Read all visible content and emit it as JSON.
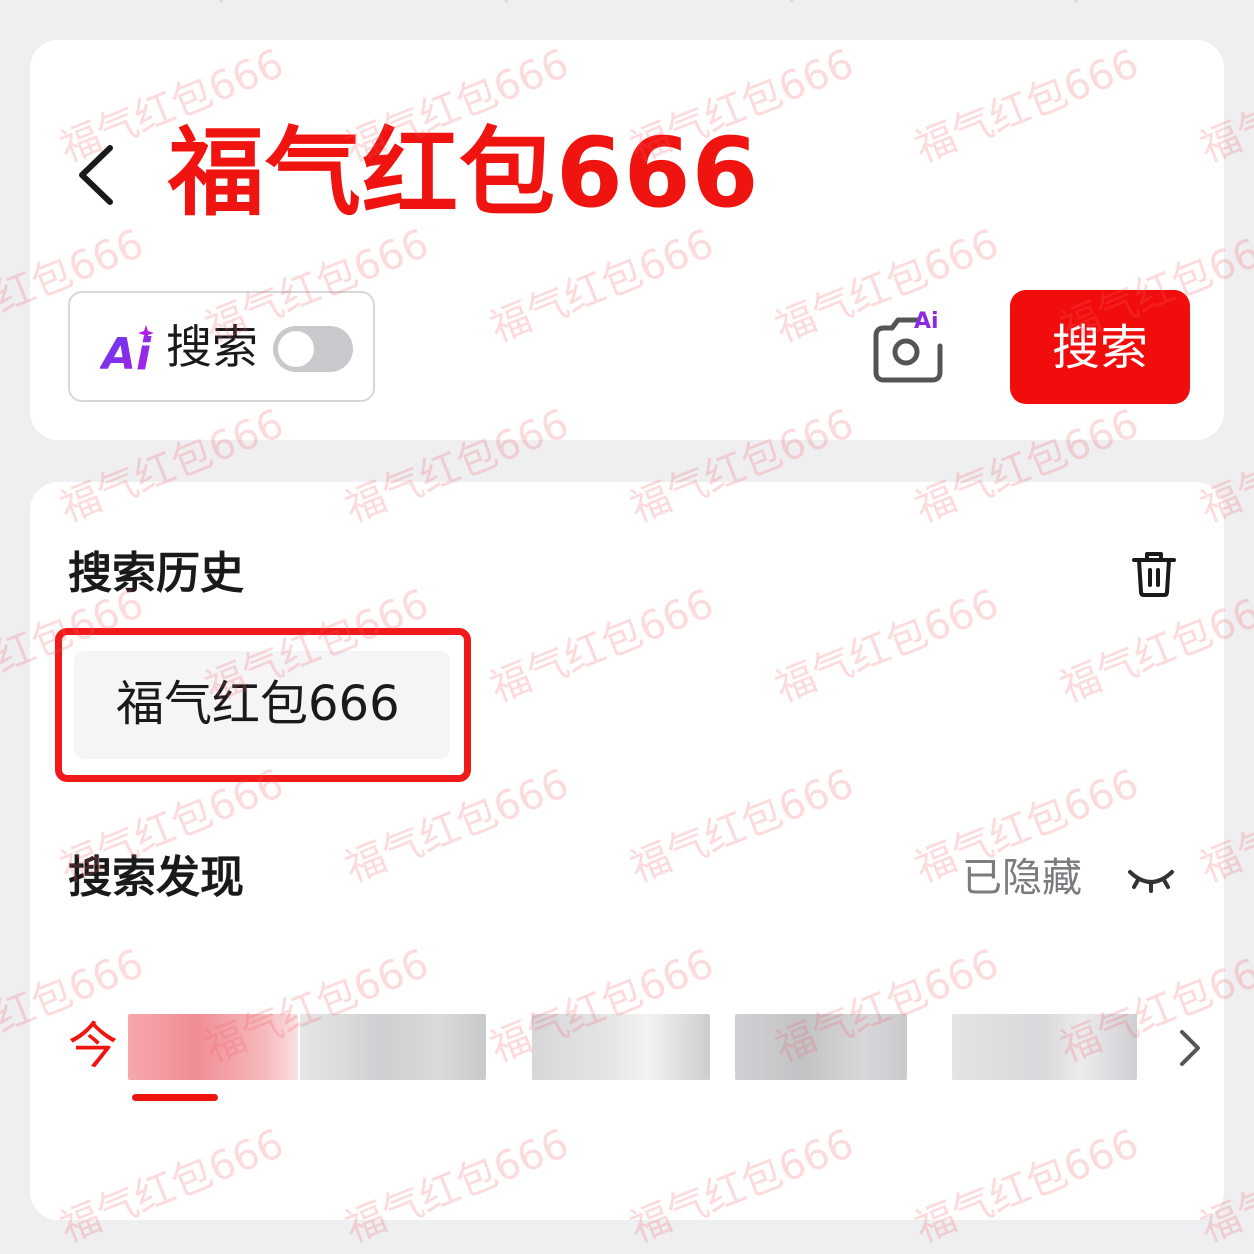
{
  "header": {
    "query": "福气红包666"
  },
  "search_bar": {
    "ai_badge": "Ai",
    "ai_label": "搜索",
    "ai_toggle_on": false,
    "camera_badge": "Ai",
    "search_button": "搜索"
  },
  "history": {
    "title": "搜索历史",
    "items": [
      "福气红包666"
    ]
  },
  "discover": {
    "title": "搜索发现",
    "status": "已隐藏",
    "active_tab": "今"
  },
  "watermark": "福气红包666",
  "colors": {
    "accent": "#f01410",
    "ai_purple": "#8a2be2"
  }
}
